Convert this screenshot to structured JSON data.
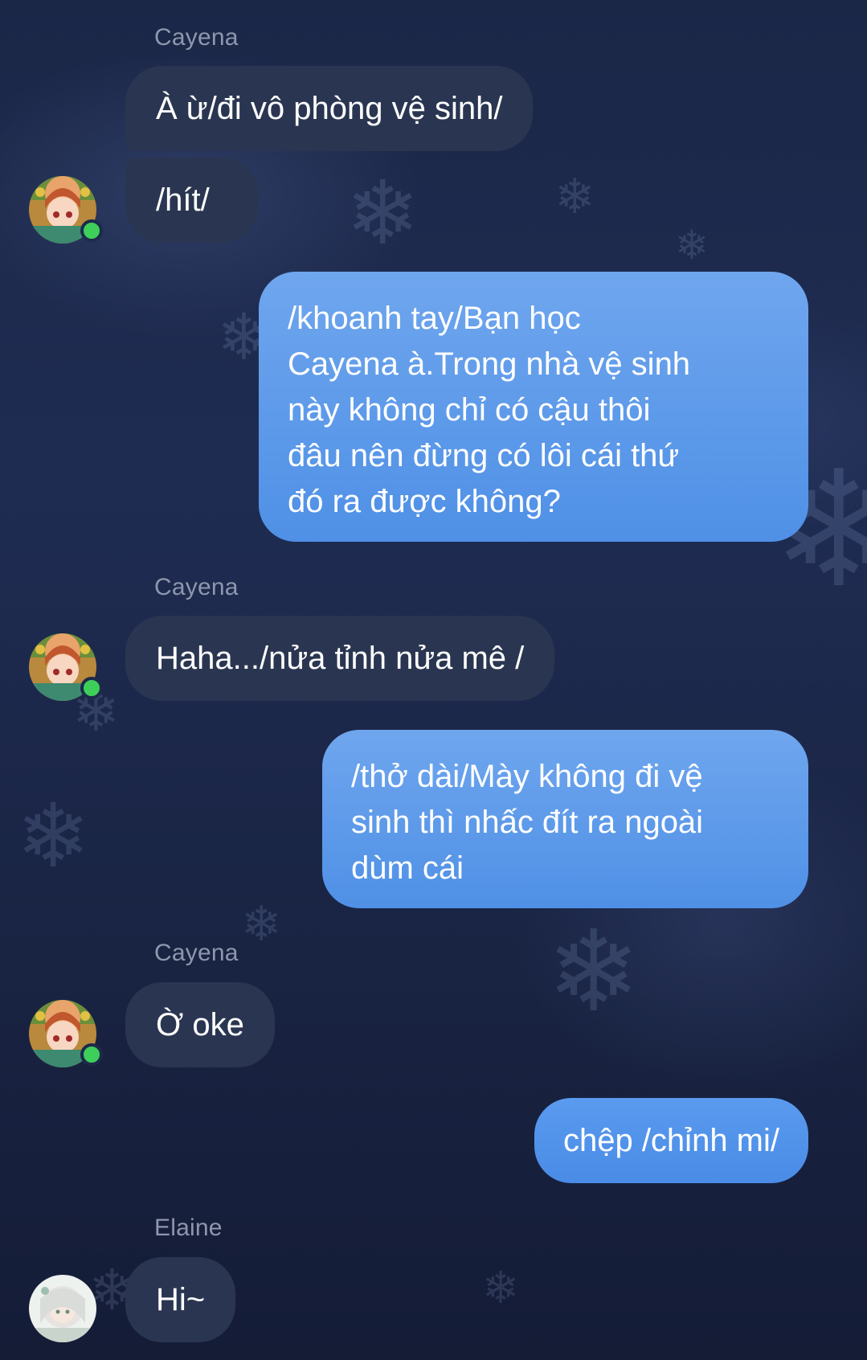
{
  "messages": [
    {
      "type": "incoming",
      "sender": "Cayena",
      "text": "À ừ/đi vô phòng vệ sinh/"
    },
    {
      "type": "incoming",
      "text": "/hít/"
    },
    {
      "type": "outgoing",
      "text": "/khoanh tay/Bạn học\nCayena à.Trong nhà vệ sinh\nnày không chỉ có cậu thôi\nđâu nên đừng có lôi cái thứ\nđó ra được không?"
    },
    {
      "type": "incoming",
      "sender": "Cayena",
      "text": "Haha.../nửa tỉnh nửa mê /"
    },
    {
      "type": "outgoing",
      "text": "/thở dài/Mày không đi vệ\nsinh thì nhấc đít ra ngoài\ndùm cái"
    },
    {
      "type": "incoming",
      "sender": "Cayena",
      "text": "Ờ oke"
    },
    {
      "type": "outgoing",
      "text": "chệp /chỉnh mi/"
    },
    {
      "type": "incoming",
      "sender": "Elaine",
      "text": "Hi~"
    }
  ],
  "colors": {
    "background": "#1c2848",
    "incoming_bubble": "#2a3651",
    "outgoing_bubble": "#5a9bef",
    "online_dot": "#3ecf5a",
    "sender_name": "#8e97ad"
  },
  "icons": {
    "cayena_avatar": "anime-avatar-icon",
    "elaine_avatar": "anime-avatar-icon",
    "online_status": "online-dot-icon"
  }
}
